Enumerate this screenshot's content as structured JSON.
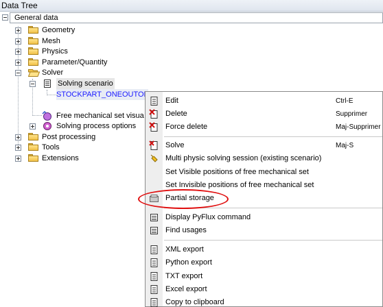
{
  "panel": {
    "title": "Data Tree"
  },
  "tree": {
    "root_label": "General data",
    "geometry": "Geometry",
    "mesh": "Mesh",
    "physics": "Physics",
    "parameter": "Parameter/Quantity",
    "solver": "Solver",
    "solving_scenario": "Solving scenario",
    "stockpart": "STOCKPART_ONEOUTOF",
    "free_mechanical": "Free mechanical set visua",
    "solving_options": "Solving process options",
    "post_processing": "Post processing",
    "tools": "Tools",
    "extensions": "Extensions"
  },
  "context_menu": {
    "edit": "Edit",
    "edit_shortcut": "Ctrl-E",
    "delete": "Delete",
    "delete_shortcut": "Supprimer",
    "force_delete": "Force delete",
    "force_delete_shortcut": "Maj-Supprimer",
    "solve": "Solve",
    "solve_shortcut": "Maj-S",
    "multi_physic": "Multi physic solving session (existing scenario)",
    "set_visible": "Set Visible positions of free mechanical set",
    "set_invisible": "Set Invisible positions of free mechanical set",
    "partial_storage": "Partial storage",
    "display_pyflux": "Display PyFlux command",
    "find_usages": "Find usages",
    "xml_export": "XML export",
    "python_export": "Python export",
    "txt_export": "TXT export",
    "excel_export": "Excel export",
    "copy_clipboard": "Copy to clipboard"
  },
  "colors": {
    "selected_text": "#1a1aff",
    "highlight_ring": "#e01010",
    "menu_strip": "#eeeeee"
  }
}
